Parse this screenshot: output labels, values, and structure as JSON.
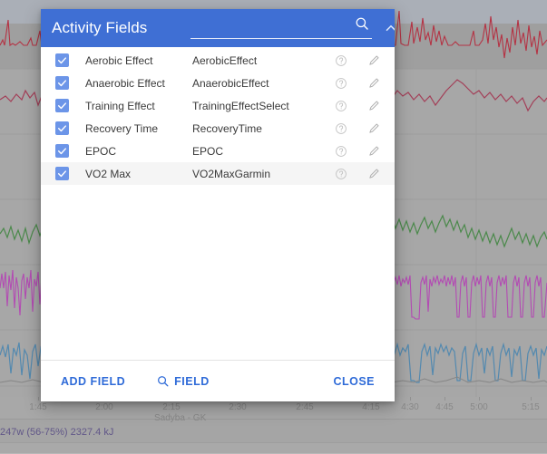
{
  "background": {
    "series_title": "Sadyba - GK",
    "footer_text": "247w (56-75%) 2327.4 kJ",
    "x_tick_labels": [
      "1:45",
      "2:00",
      "2:15",
      "2:30",
      "2:45",
      "4:15",
      "4:30",
      "4:45",
      "5:00",
      "5:15"
    ],
    "trace_colors": {
      "heart_rate": "#c62036",
      "altitude": "#b03050",
      "cadence": "#3f8f3f",
      "power": "#c43fc4",
      "speed": "#4a8fbf",
      "other": "#8a8a8a"
    },
    "accent_purple": "#5b4e8e"
  },
  "dialog": {
    "title": "Activity Fields",
    "accent_color": "#3f6fd4",
    "link_color": "#2f6bd8",
    "search": {
      "value": "",
      "placeholder": ""
    },
    "header_icons": {
      "search": "search-icon",
      "collapse": "chevron-up-icon",
      "expand": "chevron-down-icon"
    },
    "fields": [
      {
        "label": "Aerobic Effect",
        "key": "AerobicEffect",
        "checked": true,
        "hovered": false
      },
      {
        "label": "Anaerobic Effect",
        "key": "AnaerobicEffect",
        "checked": true,
        "hovered": false
      },
      {
        "label": "Training Effect",
        "key": "TrainingEffectSelect",
        "checked": true,
        "hovered": false
      },
      {
        "label": "Recovery Time",
        "key": "RecoveryTime",
        "checked": true,
        "hovered": false
      },
      {
        "label": "EPOC",
        "key": "EPOC",
        "checked": true,
        "hovered": false
      },
      {
        "label": "VO2 Max",
        "key": "VO2MaxGarmin",
        "checked": true,
        "hovered": true
      }
    ],
    "actions": {
      "add_field": "ADD FIELD",
      "find_field": "FIELD",
      "close": "CLOSE"
    }
  }
}
